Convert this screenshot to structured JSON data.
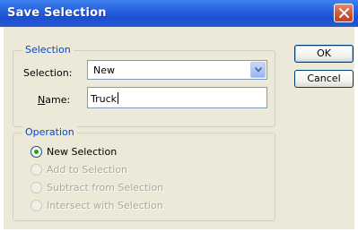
{
  "window": {
    "title": "Save Selection"
  },
  "selection_group": {
    "legend": "Selection",
    "selection_label": "Selection:",
    "selection_value": "New",
    "name_label_accel": "N",
    "name_label_rest": "ame:",
    "name_value": "Truck"
  },
  "operation_group": {
    "legend": "Operation",
    "options": [
      {
        "label": "New Selection",
        "selected": true,
        "enabled": true
      },
      {
        "label": "Add to Selection",
        "selected": false,
        "enabled": false
      },
      {
        "label": "Subtract from Selection",
        "selected": false,
        "enabled": false
      },
      {
        "label": "Intersect with Selection",
        "selected": false,
        "enabled": false
      }
    ]
  },
  "buttons": {
    "ok": "OK",
    "cancel": "Cancel"
  },
  "colors": {
    "title_bar": "#2a64e0",
    "legend_text": "#0046d5",
    "dialog_bg": "#ece9d8",
    "close_button": "#d4573a"
  },
  "icons": {
    "close": "close-icon",
    "dropdown": "chevron-down-icon"
  }
}
